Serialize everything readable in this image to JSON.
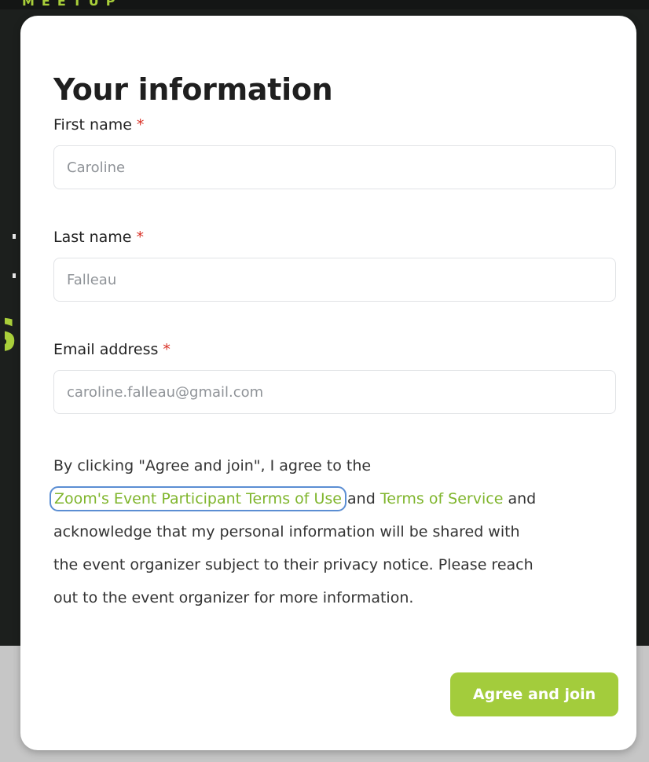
{
  "modal": {
    "title": "Your information",
    "required_marker": "*",
    "fields": [
      {
        "label": "First name",
        "value": "Caroline"
      },
      {
        "label": "Last name",
        "value": "Falleau"
      },
      {
        "label": "Email address",
        "value": "caroline.falleau@gmail.com"
      }
    ],
    "terms": {
      "line1": "By clicking \"Agree and join\", I agree to the",
      "link_participant_terms": "Zoom's Event Participant Terms of Use",
      "and1": " and ",
      "link_terms_of_service": "Terms of Service",
      "and2": " and",
      "line3": "acknowledge that my personal information will be shared with",
      "line4": "the event organizer subject to their privacy notice. Please reach",
      "line5": "out to the event organizer for more information."
    },
    "submit_label": "Agree and join"
  },
  "colors": {
    "accent": "#a3cc3c",
    "link": "#7fb52c",
    "required": "#d93025",
    "focus_ring": "#5b8ed3",
    "backdrop_dark": "#1c1f1d"
  }
}
